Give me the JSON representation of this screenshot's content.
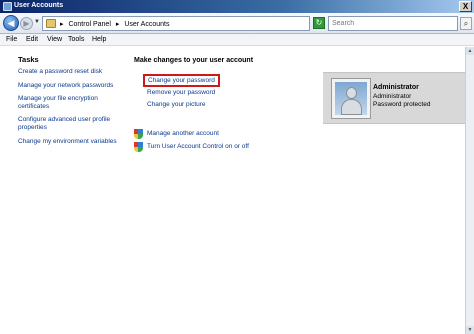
{
  "window": {
    "title": "User Accounts",
    "close_label": "X"
  },
  "address": {
    "crumbs": [
      "Control Panel",
      "User Accounts"
    ],
    "separator": "▸",
    "search_placeholder": "Search"
  },
  "menu": [
    "File",
    "Edit",
    "View",
    "Tools",
    "Help"
  ],
  "tasks": {
    "title": "Tasks",
    "items": [
      "Create a password reset disk",
      "Manage your network passwords",
      "Manage your file encryption certificates",
      "Configure advanced user profile properties",
      "Change my environment variables"
    ]
  },
  "main": {
    "heading": "Make changes to your user account",
    "links": [
      "Change your password",
      "Remove your password",
      "Change your picture"
    ],
    "shield_links": [
      "Manage another account",
      "Turn User Account Control on or off"
    ]
  },
  "user": {
    "name": "Administrator",
    "role": "Administrator",
    "status": "Password protected"
  },
  "icons": {
    "back": "back-arrow-icon",
    "forward": "forward-arrow-icon",
    "refresh": "refresh-icon",
    "search": "search-icon",
    "shield": "uac-shield-icon"
  },
  "colors": {
    "link": "#0b3a8c",
    "highlight_border": "#cc1a1a",
    "title_bar": "#0a246a"
  }
}
